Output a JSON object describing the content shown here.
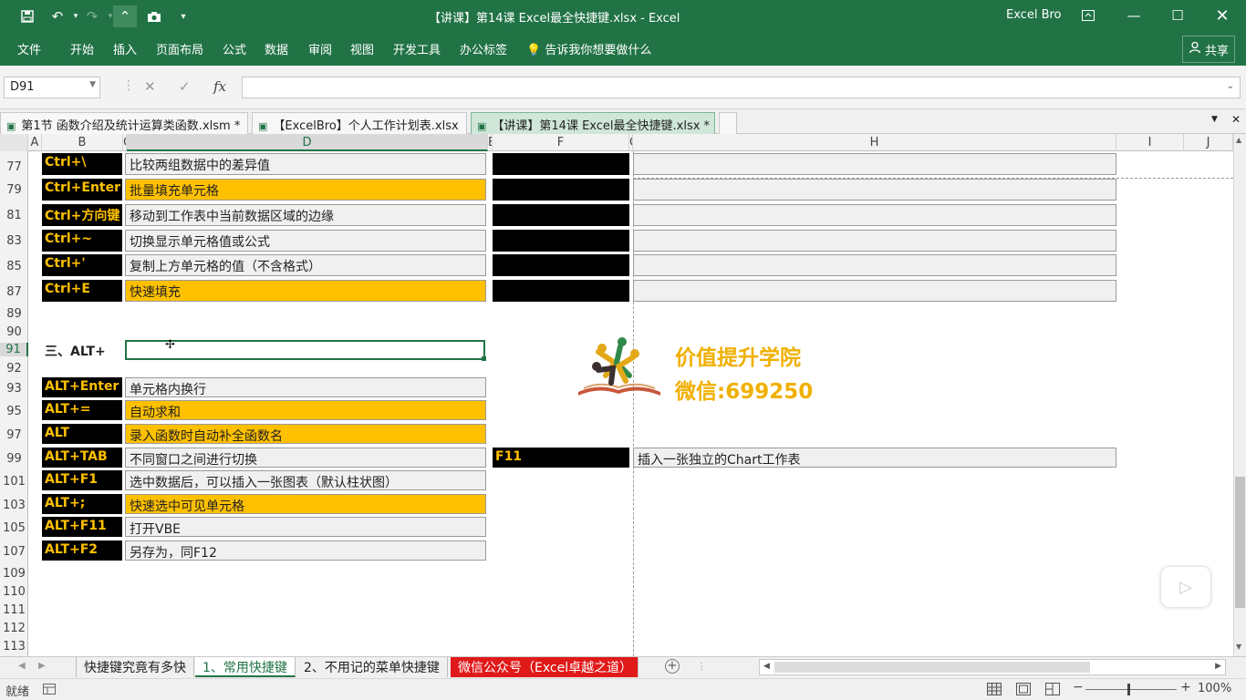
{
  "window": {
    "title": "【讲课】第14课 Excel最全快捷键.xlsx  -  Excel",
    "account": "Excel Bro"
  },
  "ribbon": {
    "tabs": [
      "文件",
      "开始",
      "插入",
      "页面布局",
      "公式",
      "数据",
      "审阅",
      "视图",
      "开发工具",
      "办公标签"
    ],
    "tell_me": "告诉我你想要做什么",
    "share": "共享"
  },
  "formula_bar": {
    "name_box": "D91",
    "fx": "fx",
    "value": ""
  },
  "doc_tabs": [
    {
      "label": "第1节 函数介绍及统计运算类函数.xlsm *"
    },
    {
      "label": "【ExcelBro】个人工作计划表.xlsx"
    },
    {
      "label": "【讲课】第14课 Excel最全快捷键.xlsx *"
    }
  ],
  "columns": [
    "A",
    "B",
    "C",
    "D",
    "E",
    "F",
    "G",
    "H",
    "I",
    "J"
  ],
  "rows": [
    "77",
    "79",
    "81",
    "83",
    "85",
    "87",
    "89",
    "90",
    "91",
    "92",
    "93",
    "95",
    "97",
    "99",
    "101",
    "103",
    "105",
    "107",
    "109",
    "110",
    "111",
    "112",
    "113"
  ],
  "ctrl_shortcuts": [
    {
      "key": "Ctrl+\\",
      "desc": "比较两组数据中的差异值",
      "style": "gray"
    },
    {
      "key": "Ctrl+Enter",
      "desc": "批量填充单元格",
      "style": "orange"
    },
    {
      "key": "Ctrl+方向键",
      "desc": "移动到工作表中当前数据区域的边缘",
      "style": "gray"
    },
    {
      "key": "Ctrl+~",
      "desc": "切换显示单元格值或公式",
      "style": "gray"
    },
    {
      "key": "Ctrl+'",
      "desc": "复制上方单元格的值（不含格式）",
      "style": "gray"
    },
    {
      "key": "Ctrl+E",
      "desc": "快速填充",
      "style": "orange"
    }
  ],
  "section_heading": "三、ALT+",
  "alt_shortcuts": [
    {
      "key": "ALT+Enter",
      "desc": "单元格内换行",
      "style": "gray"
    },
    {
      "key": "ALT+=",
      "desc": "自动求和",
      "style": "orange"
    },
    {
      "key": "ALT",
      "desc": "录入函数时自动补全函数名",
      "style": "orange"
    },
    {
      "key": "ALT+TAB",
      "desc": "不同窗口之间进行切换",
      "style": "gray"
    },
    {
      "key": "ALT+F1",
      "desc": "选中数据后，可以插入一张图表（默认柱状图）",
      "style": "gray"
    },
    {
      "key": "ALT+;",
      "desc": "快速选中可见单元格",
      "style": "orange"
    },
    {
      "key": "ALT+F11",
      "desc": "打开VBE",
      "style": "gray"
    },
    {
      "key": "ALT+F2",
      "desc": "另存为，同F12",
      "style": "gray"
    }
  ],
  "f11": {
    "key": "F11",
    "desc": "插入一张独立的Chart工作表"
  },
  "watermark": {
    "line1": "价值提升学院",
    "line2": "微信:699250"
  },
  "sheet_tabs": [
    {
      "label": "快捷键究竟有多快",
      "state": "normal"
    },
    {
      "label": "1、常用快捷键",
      "state": "active"
    },
    {
      "label": "2、不用记的菜单快捷键",
      "state": "normal"
    },
    {
      "label": "微信公众号（Excel卓越之道）",
      "state": "red"
    }
  ],
  "status": {
    "mode": "就绪",
    "zoom": "100%"
  }
}
